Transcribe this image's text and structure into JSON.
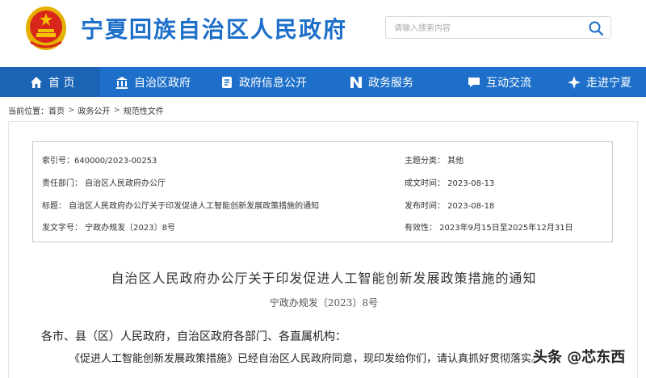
{
  "header": {
    "site_title": "宁夏回族自治区人民政府",
    "search_placeholder": "请输入搜索内容"
  },
  "nav": [
    {
      "label": "首 页",
      "icon": "home-icon"
    },
    {
      "label": "自治区政府",
      "icon": "building-icon"
    },
    {
      "label": "政府信息公开",
      "icon": "document-icon"
    },
    {
      "label": "政务服务",
      "icon": "service-icon"
    },
    {
      "label": "互动交流",
      "icon": "chat-icon"
    },
    {
      "label": "走进宁夏",
      "icon": "compass-icon"
    }
  ],
  "breadcrumb": {
    "prefix": "当前位置：",
    "items": [
      "首页",
      "政务公开",
      "规范性文件"
    ],
    "sep": ">"
  },
  "meta": {
    "index_no": "索引号：640000/2023-00253",
    "category": "主题分类：   其他",
    "department": "责任部门：   自治区人民政府办公厅",
    "created": "成文时间：   2023-08-13",
    "title": "标题：   自治区人民政府办公厅关于印发促进人工智能创新发展政策措施的通知",
    "published": "发布时间：   2023-08-18",
    "doc_no": "发文字号：   宁政办规发〔2023〕8号",
    "validity": "有效性：   2023年9月15日至2025年12月31日"
  },
  "doc": {
    "title": "自治区人民政府办公厅关于印发促进人工智能创新发展政策措施的通知",
    "number": "宁政办规发〔2023〕8号",
    "para1": "各市、县（区）人民政府，自治区政府各部门、各直属机构：",
    "para2": "《促进人工智能创新发展政策措施》已经自治区人民政府同意，现印发给你们，请认真抓好贯彻落实。"
  },
  "watermark": "头条 @芯东西",
  "colors": {
    "brand_blue": "#1d6fc9",
    "emblem_red": "#d8261c",
    "emblem_gold": "#f3c200"
  }
}
